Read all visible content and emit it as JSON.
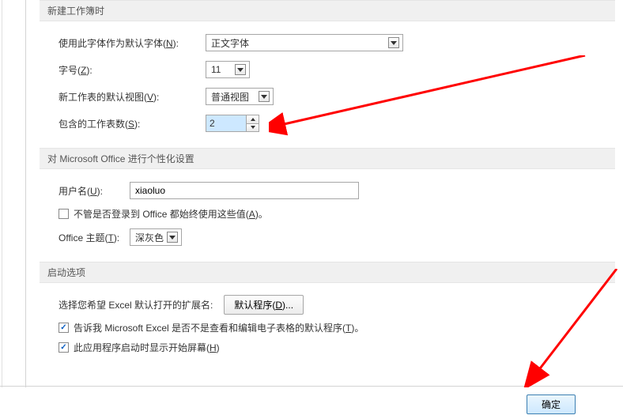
{
  "sections": {
    "newWorkbook": {
      "header": "新建工作簿时",
      "defaultFont": {
        "label": "使用此字体作为默认字体(",
        "hotkey": "N",
        "labelEnd": "):",
        "value": "正文字体"
      },
      "fontSize": {
        "label": "字号(",
        "hotkey": "Z",
        "labelEnd": "):",
        "value": "11"
      },
      "defaultView": {
        "label": "新工作表的默认视图(",
        "hotkey": "V",
        "labelEnd": "):",
        "value": "普通视图"
      },
      "sheetCount": {
        "label": "包含的工作表数(",
        "hotkey": "S",
        "labelEnd": "):",
        "value": "2"
      }
    },
    "personalize": {
      "header": "对 Microsoft Office 进行个性化设置",
      "username": {
        "label": "用户名(",
        "hotkey": "U",
        "labelEnd": "):",
        "value": "xiaoluo"
      },
      "alwaysUse": {
        "label": "不管是否登录到 Office 都始终使用这些值(",
        "hotkey": "A",
        "labelEnd": ")。",
        "checked": false
      },
      "theme": {
        "label": "Office 主题(",
        "hotkey": "T",
        "labelEnd": "):",
        "value": "深灰色"
      }
    },
    "startup": {
      "header": "启动选项",
      "extensions": {
        "label": "选择您希望 Excel 默认打开的扩展名:",
        "button": "默认程序(",
        "buttonHotkey": "D",
        "buttonEnd": ")..."
      },
      "tellMe": {
        "label": "告诉我 Microsoft Excel 是否不是查看和编辑电子表格的默认程序(",
        "hotkey": "T",
        "labelEnd": ")。",
        "checked": true
      },
      "showStart": {
        "label": "此应用程序启动时显示开始屏幕(",
        "hotkey": "H",
        "labelEnd": ")",
        "checked": true
      }
    }
  },
  "buttons": {
    "ok": "确定"
  }
}
